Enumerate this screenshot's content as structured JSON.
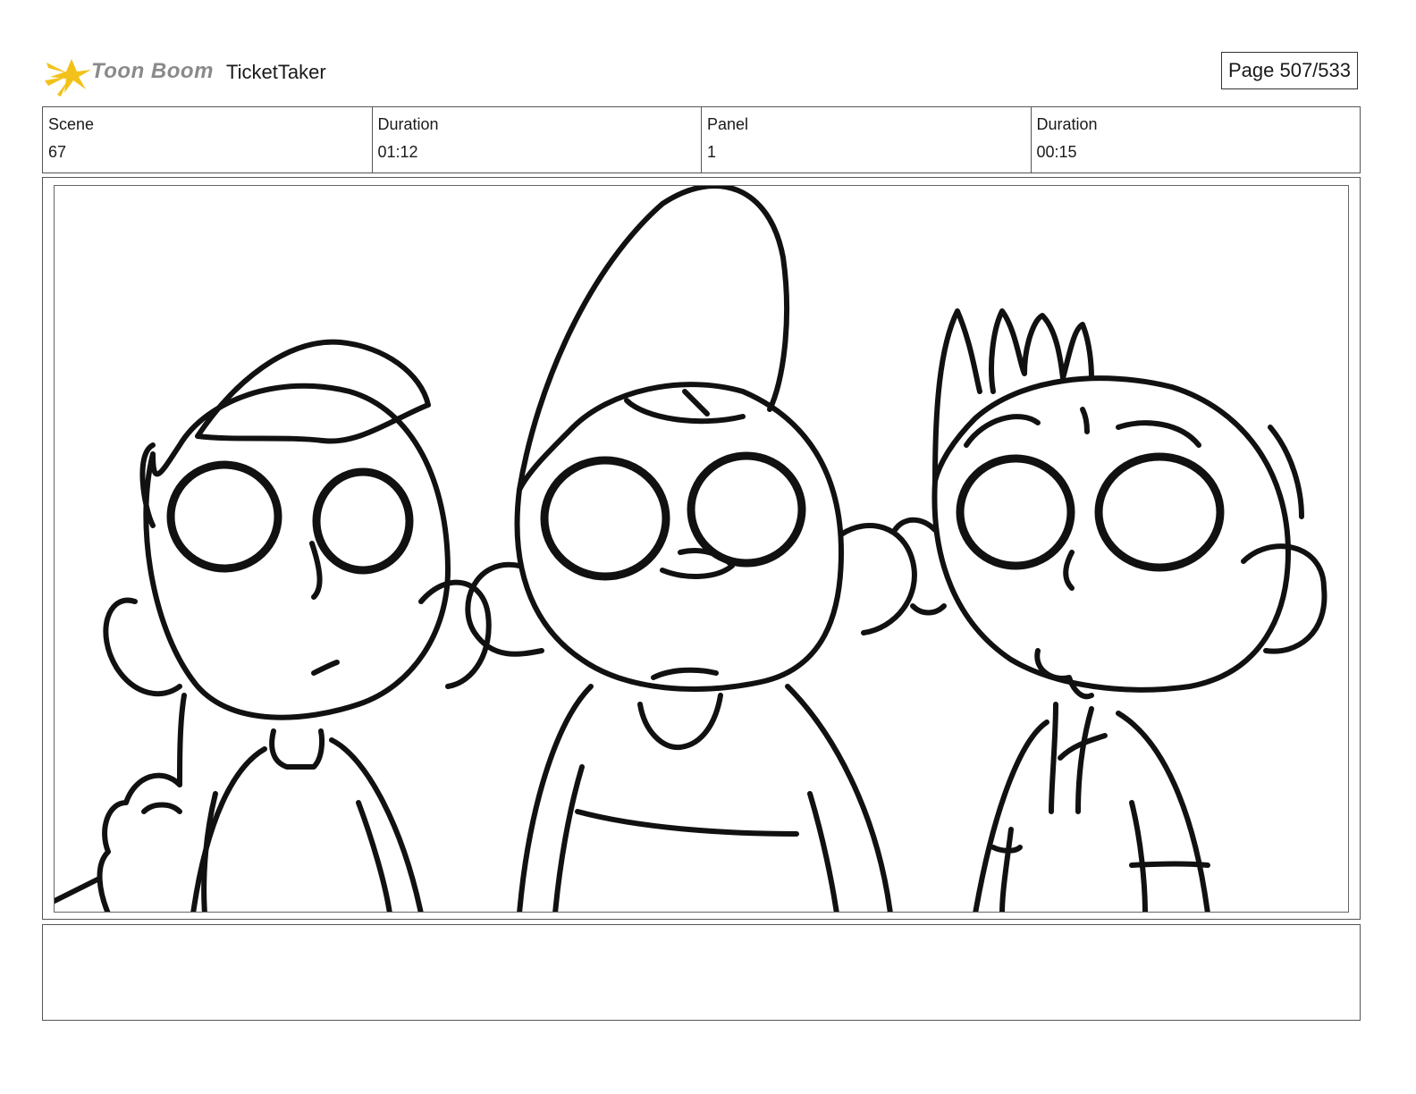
{
  "header": {
    "brand": "Toon Boom",
    "project_title": "TicketTaker",
    "page_label": "Page 507/533"
  },
  "info": {
    "scene_label": "Scene",
    "scene_value": "67",
    "scene_duration_label": "Duration",
    "scene_duration_value": "01:12",
    "panel_label": "Panel",
    "panel_value": "1",
    "panel_duration_label": "Duration",
    "panel_duration_value": "00:15"
  },
  "notes": {
    "text": ""
  },
  "colors": {
    "logo_star": "#f2c21b",
    "brand_text": "#8a8a8a",
    "ink": "#111111"
  }
}
